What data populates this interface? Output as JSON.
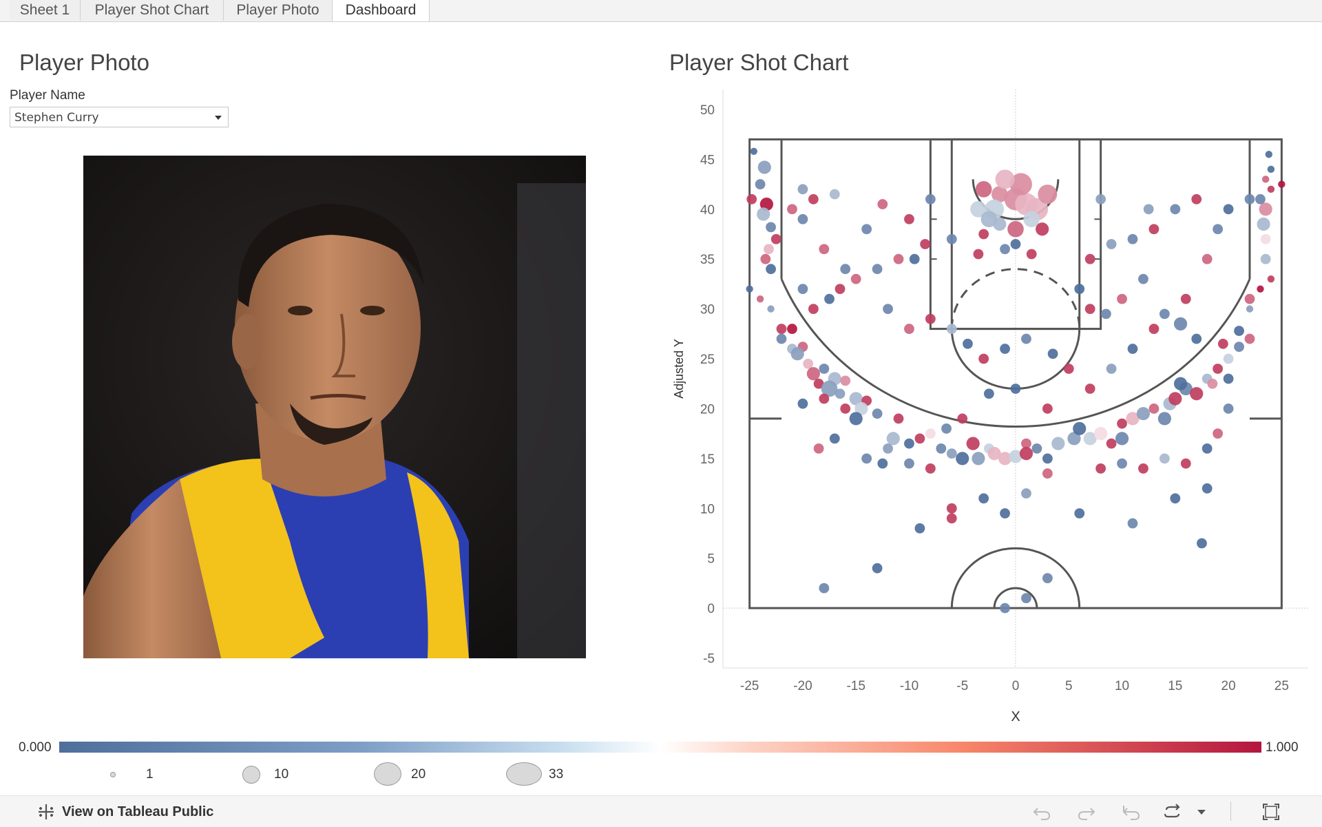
{
  "tabs": [
    {
      "label": "Sheet 1"
    },
    {
      "label": "Player Shot Chart"
    },
    {
      "label": "Player Photo"
    },
    {
      "label": "Dashboard",
      "active": true
    }
  ],
  "photo_panel": {
    "title": "Player Photo",
    "filter_label": "Player Name",
    "selected_player": "Stephen Curry"
  },
  "chart_panel": {
    "title": "Player Shot Chart"
  },
  "chart_data": {
    "type": "scatter",
    "title": "Player Shot Chart",
    "xlabel": "X",
    "ylabel": "Adjusted Y",
    "xlim": [
      -27.5,
      27.5
    ],
    "ylim": [
      -6,
      52
    ],
    "xticks": [
      -25,
      -20,
      -15,
      -10,
      -5,
      0,
      5,
      10,
      15,
      20,
      25
    ],
    "yticks": [
      -5,
      0,
      5,
      10,
      15,
      20,
      25,
      30,
      35,
      40,
      45,
      50
    ],
    "color_field_range": [
      0,
      1
    ],
    "colors": {
      "low": "#4e6f9c",
      "mid": "#ffffff",
      "high": "#b3163f"
    },
    "points": [
      [
        -24.6,
        45.8,
        0.0,
        1
      ],
      [
        -23.6,
        44.2,
        0.2,
        3
      ],
      [
        -24.0,
        42.5,
        0.1,
        2
      ],
      [
        -24.8,
        41.0,
        0.9,
        2
      ],
      [
        -23.4,
        40.5,
        1.0,
        3
      ],
      [
        -23.7,
        39.5,
        0.3,
        3
      ],
      [
        -23.0,
        38.2,
        0.1,
        2
      ],
      [
        -23.2,
        36.0,
        0.6,
        2
      ],
      [
        -23.5,
        35.0,
        0.8,
        2
      ],
      [
        -23.0,
        34.0,
        0.0,
        2
      ],
      [
        -25.0,
        32.0,
        0.0,
        1
      ],
      [
        -24.0,
        31.0,
        0.8,
        1
      ],
      [
        -23.0,
        30.0,
        0.2,
        1
      ],
      [
        -22.0,
        28.0,
        0.9,
        2
      ],
      [
        -21.0,
        28.0,
        1.0,
        2
      ],
      [
        -22.0,
        27.0,
        0.1,
        2
      ],
      [
        -20.0,
        26.2,
        0.8,
        2
      ],
      [
        -21.0,
        26.0,
        0.3,
        2
      ],
      [
        -20.5,
        25.5,
        0.2,
        3
      ],
      [
        -19.5,
        24.5,
        0.6,
        2
      ],
      [
        -18.0,
        24.0,
        0.1,
        2
      ],
      [
        -19.0,
        23.5,
        0.8,
        3
      ],
      [
        -17.0,
        23.0,
        0.3,
        3
      ],
      [
        -16.0,
        22.8,
        0.7,
        2
      ],
      [
        -18.5,
        22.5,
        0.9,
        2
      ],
      [
        -17.5,
        22.0,
        0.2,
        4
      ],
      [
        -16.5,
        21.5,
        0.2,
        2
      ],
      [
        -15.0,
        21.0,
        0.3,
        3
      ],
      [
        -14.0,
        20.8,
        0.9,
        2
      ],
      [
        -16.0,
        20.0,
        0.9,
        2
      ],
      [
        -14.5,
        20.0,
        0.4,
        3
      ],
      [
        -13.0,
        19.5,
        0.1,
        2
      ],
      [
        -15.0,
        19.0,
        0.0,
        3
      ],
      [
        -11.0,
        19.0,
        0.9,
        2
      ],
      [
        -11.5,
        17.0,
        0.3,
        3
      ],
      [
        -10.0,
        16.5,
        0.0,
        2
      ],
      [
        -9.0,
        17.0,
        0.9,
        2
      ],
      [
        -12.0,
        16.0,
        0.2,
        2
      ],
      [
        -8.0,
        17.5,
        0.5,
        2
      ],
      [
        -7.0,
        16.0,
        0.1,
        2
      ],
      [
        -6.0,
        15.5,
        0.2,
        2
      ],
      [
        -5.0,
        15.0,
        0.0,
        3
      ],
      [
        -4.0,
        16.5,
        0.9,
        3
      ],
      [
        -3.5,
        15.0,
        0.2,
        3
      ],
      [
        -2.5,
        16.0,
        0.4,
        2
      ],
      [
        -2.0,
        15.5,
        0.6,
        3
      ],
      [
        -1.0,
        15.0,
        0.6,
        3
      ],
      [
        0.0,
        15.2,
        0.4,
        3
      ],
      [
        1.0,
        16.5,
        0.8,
        2
      ],
      [
        1.0,
        15.5,
        0.9,
        3
      ],
      [
        2.0,
        16.0,
        0.1,
        2
      ],
      [
        3.0,
        15.0,
        0.0,
        2
      ],
      [
        4.0,
        16.5,
        0.3,
        3
      ],
      [
        5.5,
        17.0,
        0.2,
        3
      ],
      [
        6.0,
        18.0,
        0.0,
        3
      ],
      [
        7.0,
        17.0,
        0.4,
        3
      ],
      [
        8.0,
        17.5,
        0.5,
        3
      ],
      [
        9.0,
        16.5,
        0.9,
        2
      ],
      [
        10.0,
        17.0,
        0.1,
        3
      ],
      [
        10.0,
        18.5,
        0.9,
        2
      ],
      [
        11.0,
        19.0,
        0.6,
        3
      ],
      [
        12.0,
        19.5,
        0.2,
        3
      ],
      [
        13.0,
        20.0,
        0.8,
        2
      ],
      [
        14.0,
        19.0,
        0.1,
        3
      ],
      [
        14.5,
        20.5,
        0.3,
        3
      ],
      [
        15.0,
        21.0,
        0.9,
        3
      ],
      [
        16.0,
        22.0,
        0.1,
        3
      ],
      [
        17.0,
        21.5,
        0.9,
        3
      ],
      [
        15.5,
        22.5,
        0.0,
        3
      ],
      [
        18.0,
        23.0,
        0.3,
        2
      ],
      [
        19.0,
        24.0,
        0.9,
        2
      ],
      [
        18.5,
        22.5,
        0.7,
        2
      ],
      [
        20.0,
        25.0,
        0.4,
        2
      ],
      [
        21.0,
        26.2,
        0.1,
        2
      ],
      [
        22.0,
        27.0,
        0.8,
        2
      ],
      [
        21.0,
        27.8,
        0.0,
        2
      ],
      [
        22.0,
        30.0,
        0.2,
        1
      ],
      [
        22.0,
        31.0,
        0.8,
        2
      ],
      [
        23.0,
        32.0,
        1.0,
        1
      ],
      [
        24.0,
        33.0,
        0.9,
        1
      ],
      [
        23.5,
        35.0,
        0.3,
        2
      ],
      [
        23.5,
        37.0,
        0.5,
        2
      ],
      [
        23.3,
        38.5,
        0.3,
        3
      ],
      [
        23.5,
        40.0,
        0.7,
        3
      ],
      [
        23.0,
        41.0,
        0.1,
        2
      ],
      [
        24.0,
        42.0,
        0.9,
        1
      ],
      [
        23.5,
        43.0,
        0.8,
        1
      ],
      [
        24.0,
        44.0,
        0.0,
        1
      ],
      [
        23.8,
        45.5,
        0.0,
        1
      ],
      [
        25.0,
        42.5,
        1.0,
        1
      ],
      [
        -1.5,
        41.5,
        0.7,
        4
      ],
      [
        0.0,
        41.0,
        0.7,
        6
      ],
      [
        1.0,
        40.5,
        0.6,
        6
      ],
      [
        -2.0,
        40.0,
        0.4,
        5
      ],
      [
        2.0,
        40.0,
        0.6,
        6
      ],
      [
        0.5,
        42.5,
        0.7,
        6
      ],
      [
        -1.0,
        43.0,
        0.6,
        5
      ],
      [
        3.0,
        41.5,
        0.7,
        5
      ],
      [
        -3.0,
        42.0,
        0.8,
        4
      ],
      [
        -3.5,
        40.0,
        0.4,
        4
      ],
      [
        -2.5,
        39.0,
        0.3,
        4
      ],
      [
        1.5,
        39.0,
        0.4,
        4
      ],
      [
        0.0,
        38.0,
        0.8,
        4
      ],
      [
        -1.5,
        38.5,
        0.3,
        3
      ],
      [
        2.5,
        38.0,
        0.9,
        3
      ],
      [
        -3.0,
        37.5,
        0.9,
        2
      ],
      [
        -1.0,
        36.0,
        0.1,
        2
      ],
      [
        0.0,
        36.5,
        0.0,
        2
      ],
      [
        1.5,
        35.5,
        0.9,
        2
      ],
      [
        -3.5,
        35.5,
        0.9,
        2
      ],
      [
        -6.0,
        37.0,
        0.1,
        2
      ],
      [
        -8.5,
        36.5,
        0.9,
        2
      ],
      [
        -9.5,
        35.0,
        0.0,
        2
      ],
      [
        -11.0,
        35.0,
        0.8,
        2
      ],
      [
        -13.0,
        34.0,
        0.1,
        2
      ],
      [
        -15.0,
        33.0,
        0.8,
        2
      ],
      [
        -16.5,
        32.0,
        0.9,
        2
      ],
      [
        -17.5,
        31.0,
        0.0,
        2
      ],
      [
        -19.0,
        30.0,
        0.9,
        2
      ],
      [
        -20.0,
        32.0,
        0.1,
        2
      ],
      [
        -12.0,
        30.0,
        0.1,
        2
      ],
      [
        -10.0,
        28.0,
        0.8,
        2
      ],
      [
        -8.0,
        29.0,
        0.9,
        2
      ],
      [
        -6.0,
        28.0,
        0.3,
        2
      ],
      [
        -4.5,
        26.5,
        0.0,
        2
      ],
      [
        -3.0,
        25.0,
        0.9,
        2
      ],
      [
        -1.0,
        26.0,
        0.0,
        2
      ],
      [
        1.0,
        27.0,
        0.1,
        2
      ],
      [
        3.5,
        25.5,
        0.0,
        2
      ],
      [
        5.0,
        24.0,
        0.9,
        2
      ],
      [
        0.0,
        22.0,
        0.0,
        2
      ],
      [
        -2.5,
        21.5,
        0.0,
        2
      ],
      [
        3.0,
        20.0,
        0.9,
        2
      ],
      [
        7.0,
        22.0,
        0.9,
        2
      ],
      [
        9.0,
        24.0,
        0.2,
        2
      ],
      [
        11.0,
        26.0,
        0.0,
        2
      ],
      [
        13.0,
        28.0,
        0.9,
        2
      ],
      [
        14.0,
        29.5,
        0.1,
        2
      ],
      [
        15.5,
        28.5,
        0.1,
        3
      ],
      [
        17.0,
        27.0,
        0.0,
        2
      ],
      [
        16.0,
        31.0,
        0.9,
        2
      ],
      [
        12.0,
        33.0,
        0.1,
        2
      ],
      [
        10.0,
        31.0,
        0.8,
        2
      ],
      [
        8.5,
        29.5,
        0.1,
        2
      ],
      [
        7.0,
        30.0,
        0.9,
        2
      ],
      [
        6.0,
        32.0,
        0.0,
        2
      ],
      [
        7.0,
        35.0,
        0.9,
        2
      ],
      [
        9.0,
        36.5,
        0.2,
        2
      ],
      [
        11.0,
        37.0,
        0.1,
        2
      ],
      [
        13.0,
        38.0,
        0.9,
        2
      ],
      [
        15.0,
        40.0,
        0.1,
        2
      ],
      [
        17.0,
        41.0,
        0.9,
        2
      ],
      [
        19.0,
        38.0,
        0.1,
        2
      ],
      [
        18.0,
        35.0,
        0.8,
        2
      ],
      [
        20.0,
        40.0,
        0.0,
        2
      ],
      [
        22.0,
        41.0,
        0.1,
        2
      ],
      [
        12.5,
        40.0,
        0.2,
        2
      ],
      [
        8.0,
        41.0,
        0.2,
        2
      ],
      [
        -8.0,
        41.0,
        0.1,
        2
      ],
      [
        -10.0,
        39.0,
        0.9,
        2
      ],
      [
        -12.5,
        40.5,
        0.8,
        2
      ],
      [
        -14.0,
        38.0,
        0.1,
        2
      ],
      [
        -17.0,
        41.5,
        0.3,
        2
      ],
      [
        -19.0,
        41.0,
        0.9,
        2
      ],
      [
        -20.0,
        42.0,
        0.2,
        2
      ],
      [
        -21.0,
        40.0,
        0.8,
        2
      ],
      [
        -20.0,
        39.0,
        0.1,
        2
      ],
      [
        -22.5,
        37.0,
        0.9,
        2
      ],
      [
        -18.0,
        36.0,
        0.8,
        2
      ],
      [
        -16.0,
        34.0,
        0.1,
        2
      ],
      [
        -9.0,
        8.0,
        0.0,
        2
      ],
      [
        -6.0,
        9.0,
        0.9,
        2
      ],
      [
        -6.0,
        10.0,
        0.9,
        2
      ],
      [
        -3.0,
        11.0,
        0.0,
        2
      ],
      [
        -1.0,
        9.5,
        0.0,
        2
      ],
      [
        1.0,
        11.5,
        0.2,
        2
      ],
      [
        3.0,
        13.5,
        0.8,
        2
      ],
      [
        6.0,
        9.5,
        0.0,
        2
      ],
      [
        11.0,
        8.5,
        0.1,
        2
      ],
      [
        15.0,
        11.0,
        0.0,
        2
      ],
      [
        18.0,
        12.0,
        0.0,
        2
      ],
      [
        17.5,
        6.5,
        0.0,
        2
      ],
      [
        -13.0,
        4.0,
        0.0,
        2
      ],
      [
        -18.0,
        2.0,
        0.1,
        2
      ],
      [
        3.0,
        3.0,
        0.1,
        2
      ],
      [
        1.0,
        1.0,
        0.1,
        2
      ],
      [
        -1.0,
        0.0,
        0.1,
        2
      ],
      [
        -5.0,
        19.0,
        0.9,
        2
      ],
      [
        -6.5,
        18.0,
        0.1,
        2
      ],
      [
        -8.0,
        14.0,
        0.9,
        2
      ],
      [
        -10.0,
        14.5,
        0.1,
        2
      ],
      [
        -12.5,
        14.5,
        0.0,
        2
      ],
      [
        -14.0,
        15.0,
        0.1,
        2
      ],
      [
        -17.0,
        17.0,
        0.0,
        2
      ],
      [
        -18.5,
        16.0,
        0.8,
        2
      ],
      [
        -18.0,
        21.0,
        0.9,
        2
      ],
      [
        -20.0,
        20.5,
        0.0,
        2
      ],
      [
        8.0,
        14.0,
        0.9,
        2
      ],
      [
        10.0,
        14.5,
        0.1,
        2
      ],
      [
        12.0,
        14.0,
        0.9,
        2
      ],
      [
        14.0,
        15.0,
        0.3,
        2
      ],
      [
        16.0,
        14.5,
        0.9,
        2
      ],
      [
        18.0,
        16.0,
        0.0,
        2
      ],
      [
        19.0,
        17.5,
        0.8,
        2
      ],
      [
        20.0,
        20.0,
        0.1,
        2
      ],
      [
        20.0,
        23.0,
        0.0,
        2
      ],
      [
        19.5,
        26.5,
        0.9,
        2
      ]
    ]
  },
  "legend": {
    "min_label": "0.000",
    "max_label": "1.000",
    "sizes": [
      {
        "label": "1",
        "diam": 8
      },
      {
        "label": "10",
        "diam": 26
      },
      {
        "label": "20",
        "diam": 36
      },
      {
        "label": "33",
        "diam": 48
      }
    ]
  },
  "footer": {
    "link_text": "View on Tableau Public"
  }
}
